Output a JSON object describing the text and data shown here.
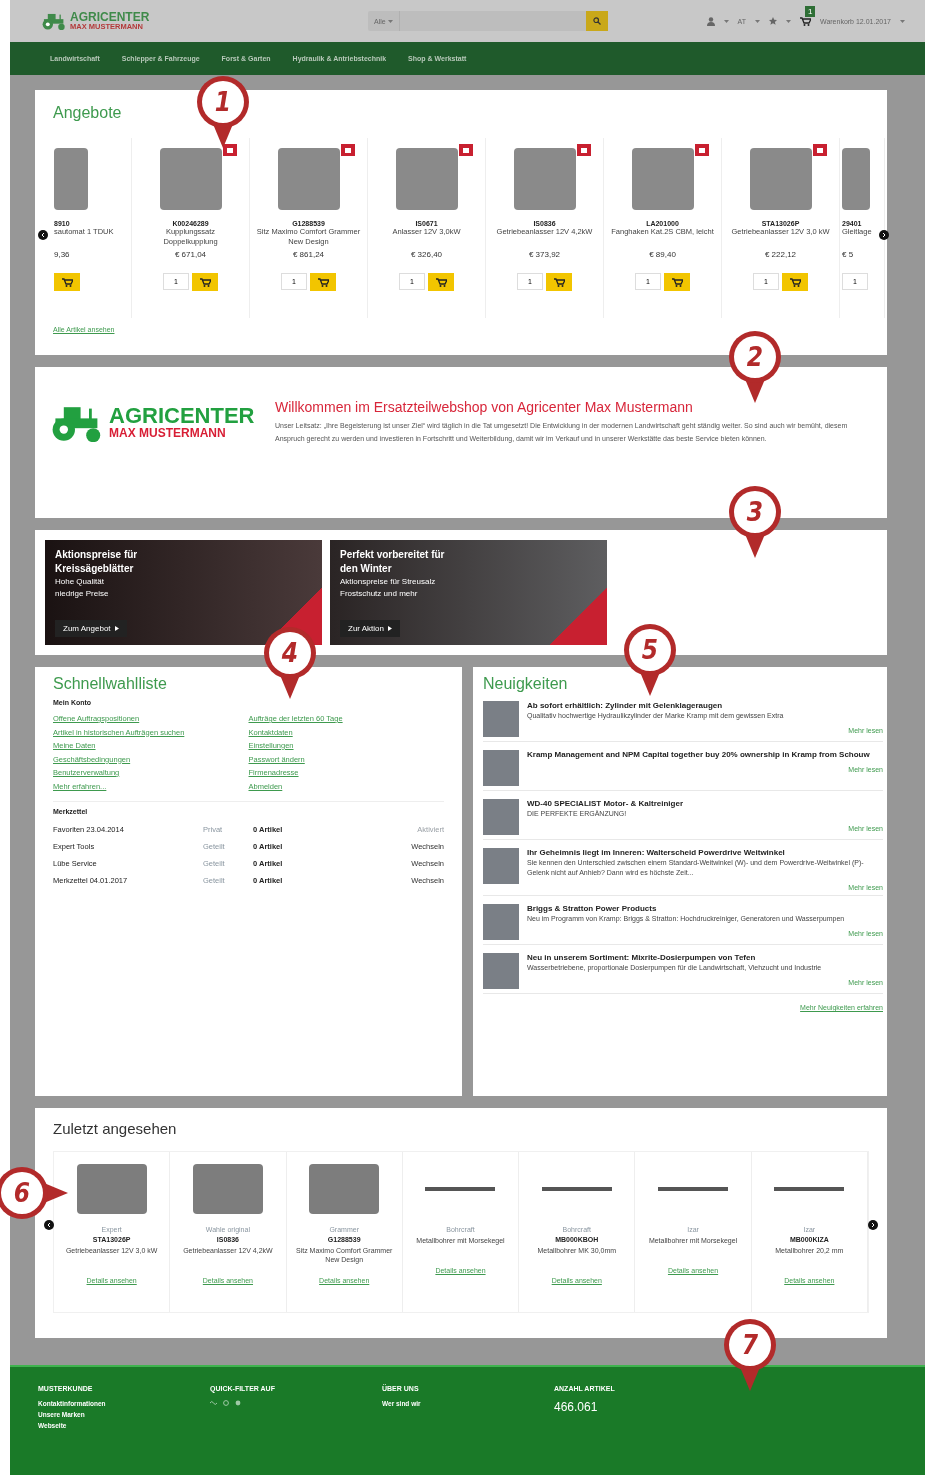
{
  "header": {
    "logo": {
      "name": "AGRICENTER",
      "subtitle": "MAX MUSTERMANN"
    },
    "search": {
      "category": "Alle"
    },
    "language": "AT",
    "cart": {
      "count": "1",
      "label": "Warenkorb 12.01.2017"
    }
  },
  "nav": [
    "Landwirtschaft",
    "Schlepper & Fahrzeuge",
    "Forst & Garten",
    "Hydraulik & Antriebstechnik",
    "Shop & Werkstatt"
  ],
  "offers": {
    "title": "Angebote",
    "link": "Alle Artikel ansehen",
    "products": [
      {
        "code": "8910",
        "name": "sautomat 1 TDUK",
        "price": "9,36"
      },
      {
        "code": "K00246289",
        "name": "Kupplungssatz Doppelkupplung",
        "price": "€ 671,04",
        "quantity": "1"
      },
      {
        "code": "G1288539",
        "name": "Sitz Maximo Comfort Grammer New Design",
        "price": "€ 861,24",
        "quantity": "1"
      },
      {
        "code": "IS0671",
        "name": "Anlasser 12V 3,0kW",
        "price": "€ 326,40",
        "quantity": "1"
      },
      {
        "code": "IS0836",
        "name": "Getriebeanlasser 12V 4,2kW",
        "price": "€ 373,92",
        "quantity": "1"
      },
      {
        "code": "LA201000",
        "name": "Fanghaken Kat.2S CBM, leicht",
        "price": "€ 89,40",
        "quantity": "1"
      },
      {
        "code": "STA13026P",
        "name": "Getriebeanlasser 12V 3,0 kW",
        "price": "€ 222,12",
        "quantity": "1"
      },
      {
        "code": "29401",
        "name": "Gleitlage",
        "price": "€ 5",
        "quantity": "1"
      }
    ]
  },
  "welcome": {
    "logo": {
      "name": "AGRICENTER",
      "subtitle": "MAX MUSTERMANN"
    },
    "title": "Willkommen im Ersatzteilwebshop von Agricenter Max Mustermann",
    "text": "Unser Leitsatz: „Ihre Begeisterung ist unser Ziel“ wird täglich in die Tat umgesetzt! Die Entwicklung in der modernen Landwirtschaft geht ständig weiter. So sind auch wir bemüht, diesem Anspruch gerecht zu werden und investieren in Fortschritt und Weiterbildung, damit wir im Verkauf und in unserer Werkstätte das beste Service bieten können."
  },
  "banners": [
    {
      "title": "Aktionspreise für Kreissägeblätter",
      "lines": [
        "Hohe Qualität",
        "niedrige Preise"
      ],
      "button": "Zum Angebot"
    },
    {
      "title": "Perfekt vorbereitet für den Winter",
      "lines": [
        "Aktionspreise für Streusalz",
        "Frostschutz und mehr"
      ],
      "button": "Zur Aktion"
    }
  ],
  "quick_list": {
    "title": "Schnellwahlliste",
    "account": {
      "heading": "Mein Konto",
      "links_left": [
        "Offene Auftragspositionen",
        "Artikel in historischen Aufträgen suchen",
        "Meine Daten",
        "Geschäftsbedingungen",
        "Benutzerverwaltung",
        "Mehr erfahren..."
      ],
      "links_right": [
        "Aufträge der letzten 60 Tage",
        "Kontaktdaten",
        "Einstellungen",
        "Passwort ändern",
        "Firmenadresse",
        "Abmelden"
      ]
    },
    "notes": {
      "heading": "Merkzettel",
      "rows": [
        {
          "name": "Favoriten 23.04.2014",
          "visibility": "Privat",
          "count": "0 Artikel",
          "action": "Aktiviert",
          "active": true
        },
        {
          "name": "Expert Tools",
          "visibility": "Geteilt",
          "count": "0 Artikel",
          "action": "Wechseln",
          "active": false
        },
        {
          "name": "Lübe Service",
          "visibility": "Geteilt",
          "count": "0 Artikel",
          "action": "Wechseln",
          "active": false
        },
        {
          "name": "Merkzettel 04.01.2017",
          "visibility": "Geteilt",
          "count": "0 Artikel",
          "action": "Wechseln",
          "active": false
        }
      ]
    }
  },
  "news": {
    "title": "Neuigkeiten",
    "more": "Mehr Neuigkeiten erfahren",
    "items": [
      {
        "title": "Ab sofort erhältlich: Zylinder mit Gelenklageraugen",
        "text": "Qualitativ hochwertige Hydraulikzylinder der Marke Kramp mit dem gewissen Extra",
        "link": "Mehr lesen"
      },
      {
        "title": "Kramp Management and NPM Capital together buy 20% ownership in Kramp from Schouw",
        "link": "Mehr lesen"
      },
      {
        "title": "WD-40 SPECIALIST Motor- & Kaltreiniger",
        "text": "DIE PERFEKTE ERGÄNZUNG!",
        "link": "Mehr lesen"
      },
      {
        "title": "Ihr Geheimnis liegt im Inneren: Walterscheid Powerdrive Weitwinkel",
        "text": "Sie kennen den Unterschied zwischen einem Standard-Weitwinkel (W)- und dem Powerdrive-Weitwinkel (P)-Gelenk nicht auf Anhieb? Dann wird es höchste Zeit...",
        "link": "Mehr lesen"
      },
      {
        "title": "Briggs & Stratton Power Products",
        "text": "Neu im Programm von Kramp: Briggs & Stratton: Hochdruckreiniger, Generatoren und Wasserpumpen",
        "link": "Mehr lesen"
      },
      {
        "title": "Neu in unserem Sortiment: Mixrite-Dosierpumpen von Tefen",
        "text": "Wasserbetriebene, proportionale Dosierpumpen für die Landwirtschaft, Viehzucht und Industrie",
        "link": "Mehr lesen"
      }
    ]
  },
  "recent": {
    "title": "Zuletzt angesehen",
    "items": [
      {
        "kind": "photo",
        "brand": "Expert",
        "code": "STA13026P",
        "name": "Getriebeanlasser 12V 3,0 kW",
        "link": "Details ansehen"
      },
      {
        "kind": "photo",
        "brand": "Wahle original",
        "code": "IS0836",
        "name": "Getriebeanlasser 12V 4,2kW",
        "link": "Details ansehen"
      },
      {
        "kind": "photo",
        "brand": "Grammer",
        "code": "G1288539",
        "name": "Sitz Maximo Comfort Grammer New Design",
        "link": "Details ansehen"
      },
      {
        "kind": "drill",
        "brand": "Bohrcraft",
        "name": "Metallbohrer mit Morsekegel",
        "link": "Details ansehen"
      },
      {
        "kind": "drill",
        "brand": "Bohrcraft",
        "code": "MB000KBOH",
        "name": "Metallbohrer MK 30,0mm",
        "link": "Details ansehen"
      },
      {
        "kind": "drill",
        "brand": "Izar",
        "name": "Metallbohrer mit Morsekegel",
        "link": "Details ansehen"
      },
      {
        "kind": "drill",
        "brand": "Izar",
        "code": "MB000KIZA",
        "name": "Metallbohrer 20,2 mm",
        "link": "Details ansehen"
      }
    ]
  },
  "footer": [
    {
      "kind": "links",
      "heading": "MUSTERKUNDE",
      "links": [
        "Kontaktinformationen",
        "Unsere Marken",
        "Webseite"
      ]
    },
    {
      "kind": "icons",
      "heading": "QUICK-FILTER AUF"
    },
    {
      "kind": "links",
      "heading": "ÜBER UNS",
      "links": [
        "Wer sind wir"
      ]
    },
    {
      "kind": "value",
      "heading": "ANZAHL ARTIKEL",
      "value": "466.061"
    }
  ],
  "callouts": [
    {
      "number": "1",
      "kind": "down"
    },
    {
      "number": "2",
      "kind": "down"
    },
    {
      "number": "3",
      "kind": "down"
    },
    {
      "number": "4",
      "kind": "down"
    },
    {
      "number": "5",
      "kind": "down"
    },
    {
      "number": "6",
      "kind": "right"
    },
    {
      "number": "7",
      "kind": "down"
    }
  ]
}
